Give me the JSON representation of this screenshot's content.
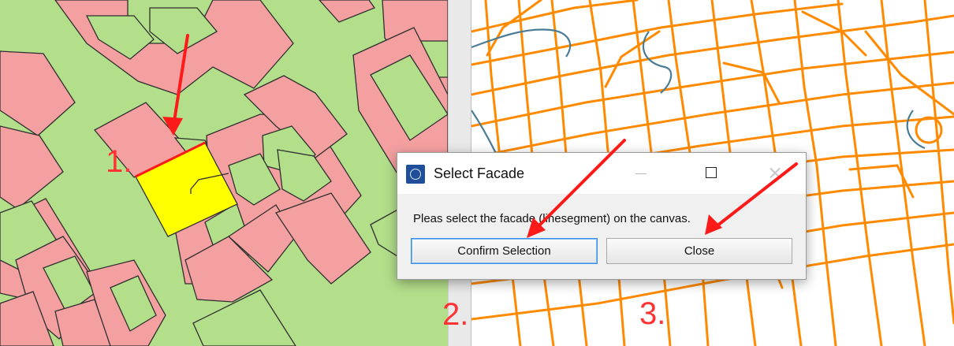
{
  "dialog": {
    "title": "Select Facade",
    "minimize_icon": "minimize-icon",
    "maximize_icon": "maximize-icon",
    "close_icon": "close-icon",
    "close_glyph": "×",
    "message": "Pleas select the facade (linesegment) on the canvas.",
    "confirm_label": "Confirm Selection",
    "close_label": "Close"
  },
  "annotations": {
    "step1": "1.",
    "step2": "2.",
    "step3": "3."
  },
  "colors": {
    "building_fill": "#f4a0a0",
    "land_fill": "#b3df8a",
    "selected_fill": "#ffff00",
    "selected_edge": "#ff1a1a",
    "street_network": "#ff8a00",
    "water_line": "#4a7c95",
    "annotation": "#ff3333"
  }
}
